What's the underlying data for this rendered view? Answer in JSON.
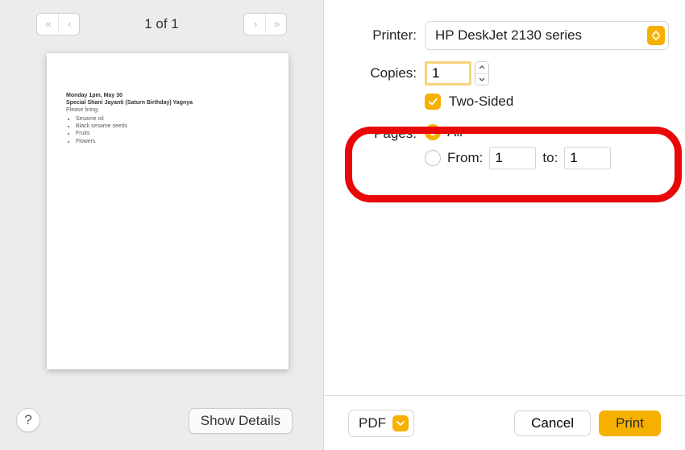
{
  "preview": {
    "page_indicator": "1 of 1",
    "doc_line1": "Monday 1pm, May 30",
    "doc_line2": "Special Shani Jayanti (Saturn Birthday) Yagnya",
    "doc_line3": "Please bring:",
    "doc_bullets": [
      "Sesame oil",
      "Black sesame seeds",
      "Fruits",
      "Flowers"
    ]
  },
  "labels": {
    "printer": "Printer:",
    "copies": "Copies:",
    "two_sided": "Two-Sided",
    "pages": "Pages:",
    "all": "All",
    "from": "From:",
    "to": "to:",
    "show_details": "Show Details",
    "pdf": "PDF",
    "cancel": "Cancel",
    "print": "Print",
    "help": "?"
  },
  "values": {
    "printer_name": "HP DeskJet 2130 series",
    "copies": "1",
    "two_sided_checked": true,
    "pages_mode": "all",
    "from": "1",
    "to": "1"
  },
  "colors": {
    "accent": "#f6b100",
    "highlight": "#e80808"
  }
}
